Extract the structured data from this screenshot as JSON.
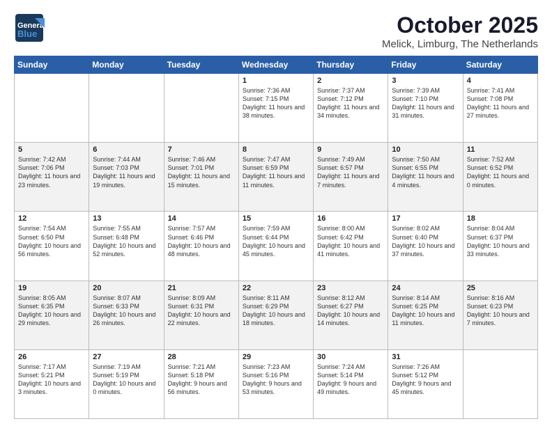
{
  "header": {
    "logo_line1": "General",
    "logo_line2": "Blue",
    "month": "October 2025",
    "location": "Melick, Limburg, The Netherlands"
  },
  "weekdays": [
    "Sunday",
    "Monday",
    "Tuesday",
    "Wednesday",
    "Thursday",
    "Friday",
    "Saturday"
  ],
  "weeks": [
    [
      {
        "day": "",
        "sunrise": "",
        "sunset": "",
        "daylight": ""
      },
      {
        "day": "",
        "sunrise": "",
        "sunset": "",
        "daylight": ""
      },
      {
        "day": "",
        "sunrise": "",
        "sunset": "",
        "daylight": ""
      },
      {
        "day": "1",
        "sunrise": "Sunrise: 7:36 AM",
        "sunset": "Sunset: 7:15 PM",
        "daylight": "Daylight: 11 hours and 38 minutes."
      },
      {
        "day": "2",
        "sunrise": "Sunrise: 7:37 AM",
        "sunset": "Sunset: 7:12 PM",
        "daylight": "Daylight: 11 hours and 34 minutes."
      },
      {
        "day": "3",
        "sunrise": "Sunrise: 7:39 AM",
        "sunset": "Sunset: 7:10 PM",
        "daylight": "Daylight: 11 hours and 31 minutes."
      },
      {
        "day": "4",
        "sunrise": "Sunrise: 7:41 AM",
        "sunset": "Sunset: 7:08 PM",
        "daylight": "Daylight: 11 hours and 27 minutes."
      }
    ],
    [
      {
        "day": "5",
        "sunrise": "Sunrise: 7:42 AM",
        "sunset": "Sunset: 7:06 PM",
        "daylight": "Daylight: 11 hours and 23 minutes."
      },
      {
        "day": "6",
        "sunrise": "Sunrise: 7:44 AM",
        "sunset": "Sunset: 7:03 PM",
        "daylight": "Daylight: 11 hours and 19 minutes."
      },
      {
        "day": "7",
        "sunrise": "Sunrise: 7:46 AM",
        "sunset": "Sunset: 7:01 PM",
        "daylight": "Daylight: 11 hours and 15 minutes."
      },
      {
        "day": "8",
        "sunrise": "Sunrise: 7:47 AM",
        "sunset": "Sunset: 6:59 PM",
        "daylight": "Daylight: 11 hours and 11 minutes."
      },
      {
        "day": "9",
        "sunrise": "Sunrise: 7:49 AM",
        "sunset": "Sunset: 6:57 PM",
        "daylight": "Daylight: 11 hours and 7 minutes."
      },
      {
        "day": "10",
        "sunrise": "Sunrise: 7:50 AM",
        "sunset": "Sunset: 6:55 PM",
        "daylight": "Daylight: 11 hours and 4 minutes."
      },
      {
        "day": "11",
        "sunrise": "Sunrise: 7:52 AM",
        "sunset": "Sunset: 6:52 PM",
        "daylight": "Daylight: 11 hours and 0 minutes."
      }
    ],
    [
      {
        "day": "12",
        "sunrise": "Sunrise: 7:54 AM",
        "sunset": "Sunset: 6:50 PM",
        "daylight": "Daylight: 10 hours and 56 minutes."
      },
      {
        "day": "13",
        "sunrise": "Sunrise: 7:55 AM",
        "sunset": "Sunset: 6:48 PM",
        "daylight": "Daylight: 10 hours and 52 minutes."
      },
      {
        "day": "14",
        "sunrise": "Sunrise: 7:57 AM",
        "sunset": "Sunset: 6:46 PM",
        "daylight": "Daylight: 10 hours and 48 minutes."
      },
      {
        "day": "15",
        "sunrise": "Sunrise: 7:59 AM",
        "sunset": "Sunset: 6:44 PM",
        "daylight": "Daylight: 10 hours and 45 minutes."
      },
      {
        "day": "16",
        "sunrise": "Sunrise: 8:00 AM",
        "sunset": "Sunset: 6:42 PM",
        "daylight": "Daylight: 10 hours and 41 minutes."
      },
      {
        "day": "17",
        "sunrise": "Sunrise: 8:02 AM",
        "sunset": "Sunset: 6:40 PM",
        "daylight": "Daylight: 10 hours and 37 minutes."
      },
      {
        "day": "18",
        "sunrise": "Sunrise: 8:04 AM",
        "sunset": "Sunset: 6:37 PM",
        "daylight": "Daylight: 10 hours and 33 minutes."
      }
    ],
    [
      {
        "day": "19",
        "sunrise": "Sunrise: 8:05 AM",
        "sunset": "Sunset: 6:35 PM",
        "daylight": "Daylight: 10 hours and 29 minutes."
      },
      {
        "day": "20",
        "sunrise": "Sunrise: 8:07 AM",
        "sunset": "Sunset: 6:33 PM",
        "daylight": "Daylight: 10 hours and 26 minutes."
      },
      {
        "day": "21",
        "sunrise": "Sunrise: 8:09 AM",
        "sunset": "Sunset: 6:31 PM",
        "daylight": "Daylight: 10 hours and 22 minutes."
      },
      {
        "day": "22",
        "sunrise": "Sunrise: 8:11 AM",
        "sunset": "Sunset: 6:29 PM",
        "daylight": "Daylight: 10 hours and 18 minutes."
      },
      {
        "day": "23",
        "sunrise": "Sunrise: 8:12 AM",
        "sunset": "Sunset: 6:27 PM",
        "daylight": "Daylight: 10 hours and 14 minutes."
      },
      {
        "day": "24",
        "sunrise": "Sunrise: 8:14 AM",
        "sunset": "Sunset: 6:25 PM",
        "daylight": "Daylight: 10 hours and 11 minutes."
      },
      {
        "day": "25",
        "sunrise": "Sunrise: 8:16 AM",
        "sunset": "Sunset: 6:23 PM",
        "daylight": "Daylight: 10 hours and 7 minutes."
      }
    ],
    [
      {
        "day": "26",
        "sunrise": "Sunrise: 7:17 AM",
        "sunset": "Sunset: 5:21 PM",
        "daylight": "Daylight: 10 hours and 3 minutes."
      },
      {
        "day": "27",
        "sunrise": "Sunrise: 7:19 AM",
        "sunset": "Sunset: 5:19 PM",
        "daylight": "Daylight: 10 hours and 0 minutes."
      },
      {
        "day": "28",
        "sunrise": "Sunrise: 7:21 AM",
        "sunset": "Sunset: 5:18 PM",
        "daylight": "Daylight: 9 hours and 56 minutes."
      },
      {
        "day": "29",
        "sunrise": "Sunrise: 7:23 AM",
        "sunset": "Sunset: 5:16 PM",
        "daylight": "Daylight: 9 hours and 53 minutes."
      },
      {
        "day": "30",
        "sunrise": "Sunrise: 7:24 AM",
        "sunset": "Sunset: 5:14 PM",
        "daylight": "Daylight: 9 hours and 49 minutes."
      },
      {
        "day": "31",
        "sunrise": "Sunrise: 7:26 AM",
        "sunset": "Sunset: 5:12 PM",
        "daylight": "Daylight: 9 hours and 45 minutes."
      },
      {
        "day": "",
        "sunrise": "",
        "sunset": "",
        "daylight": ""
      }
    ]
  ]
}
